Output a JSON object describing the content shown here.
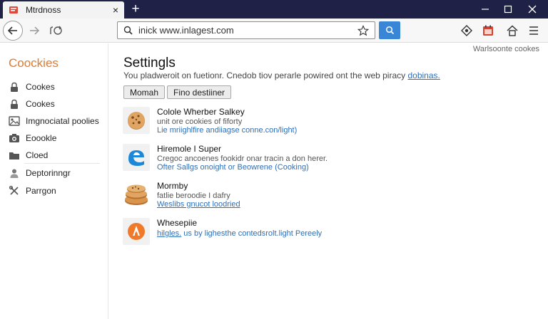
{
  "browser": {
    "tab_title": "Mtrdnoss",
    "tab_close": "×",
    "new_tab": "+",
    "url": "inick www.inlagest.com",
    "favicon": "browser-favicon-icon"
  },
  "sidebar": {
    "title": "Coockies",
    "items": [
      {
        "label": "Cookes",
        "icon": "lock-icon"
      },
      {
        "label": "Cookes",
        "icon": "lock-icon"
      },
      {
        "label": "Imgnociatal poolies",
        "icon": "image-icon"
      },
      {
        "label": "Eoookle",
        "icon": "camera-icon"
      },
      {
        "label": "Cloed",
        "icon": "folder-icon"
      },
      {
        "label": "Deptorinngr",
        "icon": "person-icon"
      },
      {
        "label": "Parrgon",
        "icon": "tools-icon"
      }
    ]
  },
  "header": {
    "corner_link": "Warlsoonte cookes"
  },
  "settings": {
    "title": "Settingls",
    "description": "You pladweroit on fuetionr. Cnedob tiov perarle powired ont the web piracy",
    "description_link": "dobinas.",
    "buttons": [
      "Momah",
      "Fino destiiner"
    ]
  },
  "entries": [
    {
      "name": "Colole Wherber Salkey",
      "sub": "unit ore cookies of fiforty",
      "link": "Lie mriighlfire andiiagse conne.con/light)",
      "icon": "cookie-icon"
    },
    {
      "name": "Hiremole I Super",
      "sub": "Cregoc ancoenes fookidr onar tracin a don herer.",
      "link": "Ofter Sallgs onoight or Beowrene (Cooking)",
      "icon": "edge-icon"
    },
    {
      "name": "Mormby",
      "sub": "fatlie beroodie I dafry",
      "link": "Weslibs gnucot loodried",
      "icon": "cookie-stack-icon"
    },
    {
      "name": "Whesepiie",
      "sub": "",
      "link_prefix": "hilgles.",
      "link": " us by lighesthe contedsrolt.light Pereely",
      "icon": "flame-icon"
    }
  ],
  "colors": {
    "titlebar": "#1f2147",
    "accent": "#e07a2e",
    "link": "#2d6fb8",
    "go_button": "#3a86d6"
  }
}
